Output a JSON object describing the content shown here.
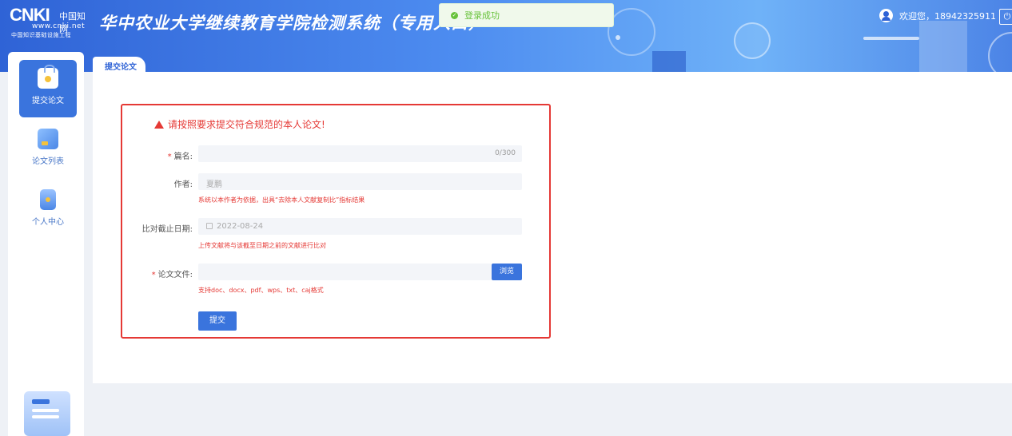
{
  "header": {
    "logo_brand": "CNKI",
    "logo_cn": "中国知网",
    "logo_url": "www.cnki.net",
    "logo_tag": "中国知识基础设施工程",
    "system_title": "华中农业大学继续教育学院检测系统（专用入口）",
    "welcome": "欢迎您，18942325911"
  },
  "toast": {
    "message": "登录成功",
    "type": "success"
  },
  "sidebar": {
    "items": [
      {
        "label": "提交论文",
        "icon": "bag-icon",
        "active": true
      },
      {
        "label": "论文列表",
        "icon": "edit-icon",
        "active": false
      },
      {
        "label": "个人中心",
        "icon": "person-icon",
        "active": false
      }
    ]
  },
  "tabs": [
    {
      "label": "提交论文",
      "active": true
    }
  ],
  "form": {
    "warning": "请按照要求提交符合规范的本人论文!",
    "title_label": "篇名:",
    "title_counter": "0/300",
    "author_label": "作者:",
    "author_value": "夏鹏",
    "author_hint": "系统以本作者为依据，出具“去除本人文献复制比”指标结果",
    "date_label": "比对截止日期:",
    "date_value": "2022-08-24",
    "date_hint": "上传文献将与该截至日期之前的文献进行比对",
    "file_label": "论文文件:",
    "browse_label": "浏览",
    "file_hint": "支持doc、docx、pdf、wps、txt、caj格式",
    "submit_label": "提交"
  },
  "colors": {
    "primary": "#3a74dd",
    "danger": "#e53935",
    "success": "#67c23a"
  }
}
